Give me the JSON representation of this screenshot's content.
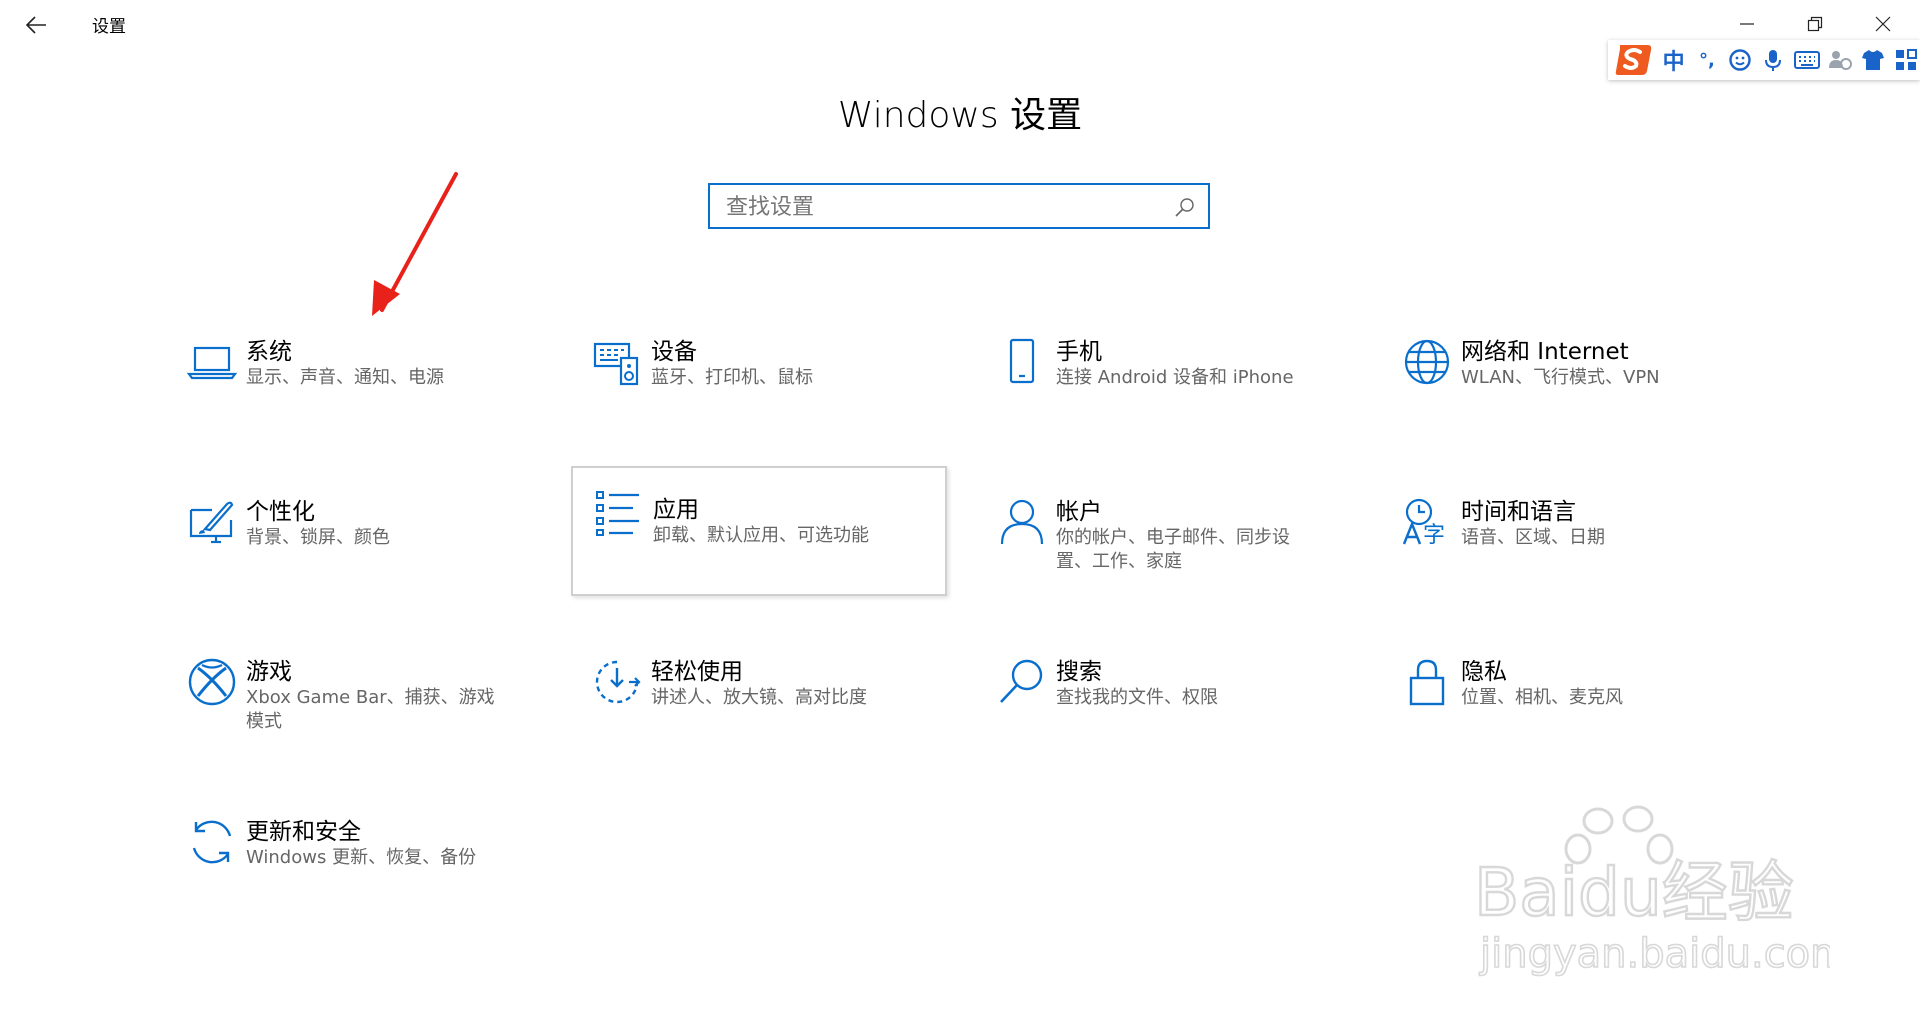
{
  "window": {
    "title": "设置"
  },
  "ime": {
    "chinese_label": "中",
    "punct_label": "°,"
  },
  "page": {
    "title": "Windows 设置"
  },
  "search": {
    "placeholder": "查找设置"
  },
  "colors": {
    "accent": "#0a6fcc",
    "arrow": "#e8221b"
  },
  "tiles": [
    {
      "title": "系统",
      "desc": "显示、声音、通知、电源",
      "icon": "laptop-icon"
    },
    {
      "title": "设备",
      "desc": "蓝牙、打印机、鼠标",
      "icon": "devices-icon"
    },
    {
      "title": "手机",
      "desc": "连接 Android 设备和 iPhone",
      "icon": "phone-icon"
    },
    {
      "title": "网络和 Internet",
      "desc": "WLAN、飞行模式、VPN",
      "icon": "globe-icon"
    },
    {
      "title": "个性化",
      "desc": "背景、锁屏、颜色",
      "icon": "personalization-icon"
    },
    {
      "title": "应用",
      "desc": "卸载、默认应用、可选功能",
      "icon": "apps-list-icon"
    },
    {
      "title": "帐户",
      "desc": "你的帐户、电子邮件、同步设置、工作、家庭",
      "icon": "person-icon"
    },
    {
      "title": "时间和语言",
      "desc": "语音、区域、日期",
      "icon": "time-language-icon"
    },
    {
      "title": "游戏",
      "desc": "Xbox Game Bar、捕获、游戏模式",
      "icon": "xbox-icon"
    },
    {
      "title": "轻松使用",
      "desc": "讲述人、放大镜、高对比度",
      "icon": "ease-of-access-icon"
    },
    {
      "title": "搜索",
      "desc": "查找我的文件、权限",
      "icon": "search-icon"
    },
    {
      "title": "隐私",
      "desc": "位置、相机、麦克风",
      "icon": "lock-icon"
    },
    {
      "title": "更新和安全",
      "desc": "Windows 更新、恢复、备份",
      "icon": "update-icon"
    }
  ],
  "watermark": {
    "text": "Baidu经验",
    "url": "jingyan.baidu.com"
  }
}
